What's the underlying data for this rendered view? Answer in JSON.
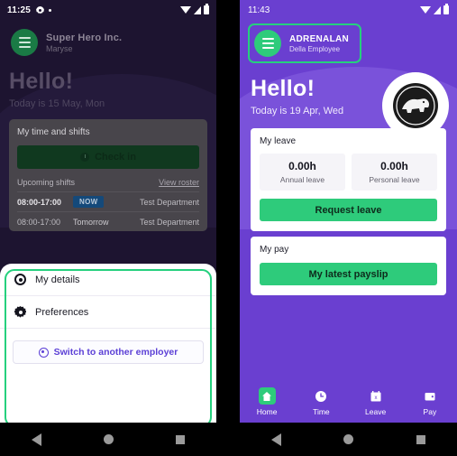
{
  "left_phone": {
    "status_bar": {
      "time": "11:25",
      "icons": [
        "gear-icon",
        "dot-icon",
        "wifi-icon",
        "signal-icon",
        "battery-icon"
      ]
    },
    "header": {
      "org": "Super Hero Inc.",
      "user": "Maryse",
      "menu_icon": "hamburger-menu-icon"
    },
    "greeting": {
      "hello": "Hello!",
      "today": "Today is 15 May, Mon"
    },
    "time_card": {
      "title": "My time and shifts",
      "check_in_label": "Check in",
      "check_in_icon": "clock-icon",
      "upcoming_label": "Upcoming shifts",
      "view_roster_label": "View roster",
      "shifts": [
        {
          "time": "08:00-17:00",
          "when": "NOW",
          "when_is_badge": true,
          "department": "Test Department"
        },
        {
          "time": "08:00-17:00",
          "when": "Tomorrow",
          "when_is_badge": false,
          "department": "Test Department"
        }
      ]
    },
    "sheet": {
      "items": [
        {
          "label": "My details",
          "icon": "person-icon"
        },
        {
          "label": "Preferences",
          "icon": "gear-icon"
        }
      ],
      "switch_label": "Switch to another employer",
      "switch_icon": "swap-employer-icon",
      "highlight_color": "#25d07d"
    }
  },
  "right_phone": {
    "status_bar": {
      "time": "11:43",
      "icons": [
        "wifi-icon",
        "signal-icon",
        "battery-icon"
      ]
    },
    "header": {
      "org": "ADRENALAN",
      "user": "Della Employee",
      "menu_icon": "hamburger-menu-icon",
      "highlight_color": "#25d07d"
    },
    "avatar": {
      "icon": "company-logo-crocodile-icon"
    },
    "greeting": {
      "hello": "Hello!",
      "today": "Today is 19 Apr, Wed"
    },
    "leave_card": {
      "title": "My leave",
      "tiles": [
        {
          "value": "0.00h",
          "label": "Annual leave"
        },
        {
          "value": "0.00h",
          "label": "Personal leave"
        }
      ],
      "button_label": "Request leave"
    },
    "pay_card": {
      "title": "My pay",
      "button_label": "My latest payslip"
    },
    "bottom_nav": [
      {
        "label": "Home",
        "icon": "home-icon",
        "active": true
      },
      {
        "label": "Time",
        "icon": "clock-icon",
        "active": false
      },
      {
        "label": "Leave",
        "icon": "calendar-icon",
        "active": false
      },
      {
        "label": "Pay",
        "icon": "wallet-icon",
        "active": false
      }
    ]
  },
  "theme": {
    "purple": "#6a3fd0",
    "green": "#2ecb7b",
    "highlight_green": "#25d07d",
    "dark_purple": "#1d1430",
    "badge_blue": "#14497a"
  }
}
